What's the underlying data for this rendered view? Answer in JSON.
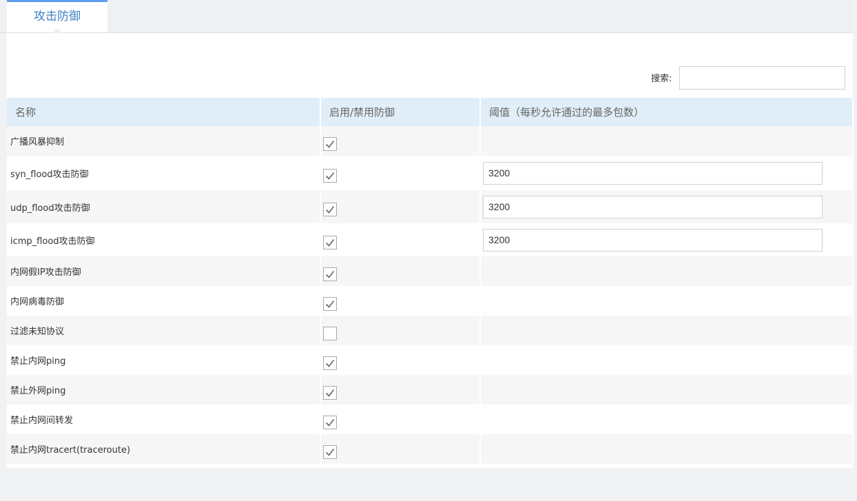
{
  "tabs": [
    {
      "label": "攻击防御",
      "active": true
    }
  ],
  "search": {
    "label": "搜索:",
    "value": ""
  },
  "table": {
    "columns": [
      "名称",
      "启用/禁用防御",
      "阈值（每秒允许通过的最多包数）"
    ],
    "rows": [
      {
        "name": "广播风暴抑制",
        "enabled": true,
        "threshold": null
      },
      {
        "name": "syn_flood攻击防御",
        "enabled": true,
        "threshold": "3200"
      },
      {
        "name": "udp_flood攻击防御",
        "enabled": true,
        "threshold": "3200"
      },
      {
        "name": "icmp_flood攻击防御",
        "enabled": true,
        "threshold": "3200"
      },
      {
        "name": "内网假IP攻击防御",
        "enabled": true,
        "threshold": null
      },
      {
        "name": "内网病毒防御",
        "enabled": true,
        "threshold": null
      },
      {
        "name": "过滤未知协议",
        "enabled": false,
        "threshold": null
      },
      {
        "name": "禁止内网ping",
        "enabled": true,
        "threshold": null
      },
      {
        "name": "禁止外网ping",
        "enabled": true,
        "threshold": null
      },
      {
        "name": "禁止内网间转发",
        "enabled": true,
        "threshold": null
      },
      {
        "name": "禁止内网tracert(traceroute)",
        "enabled": true,
        "threshold": null
      }
    ]
  },
  "colors": {
    "accent": "#5d9cec",
    "header_bg": "#dfeef8"
  }
}
